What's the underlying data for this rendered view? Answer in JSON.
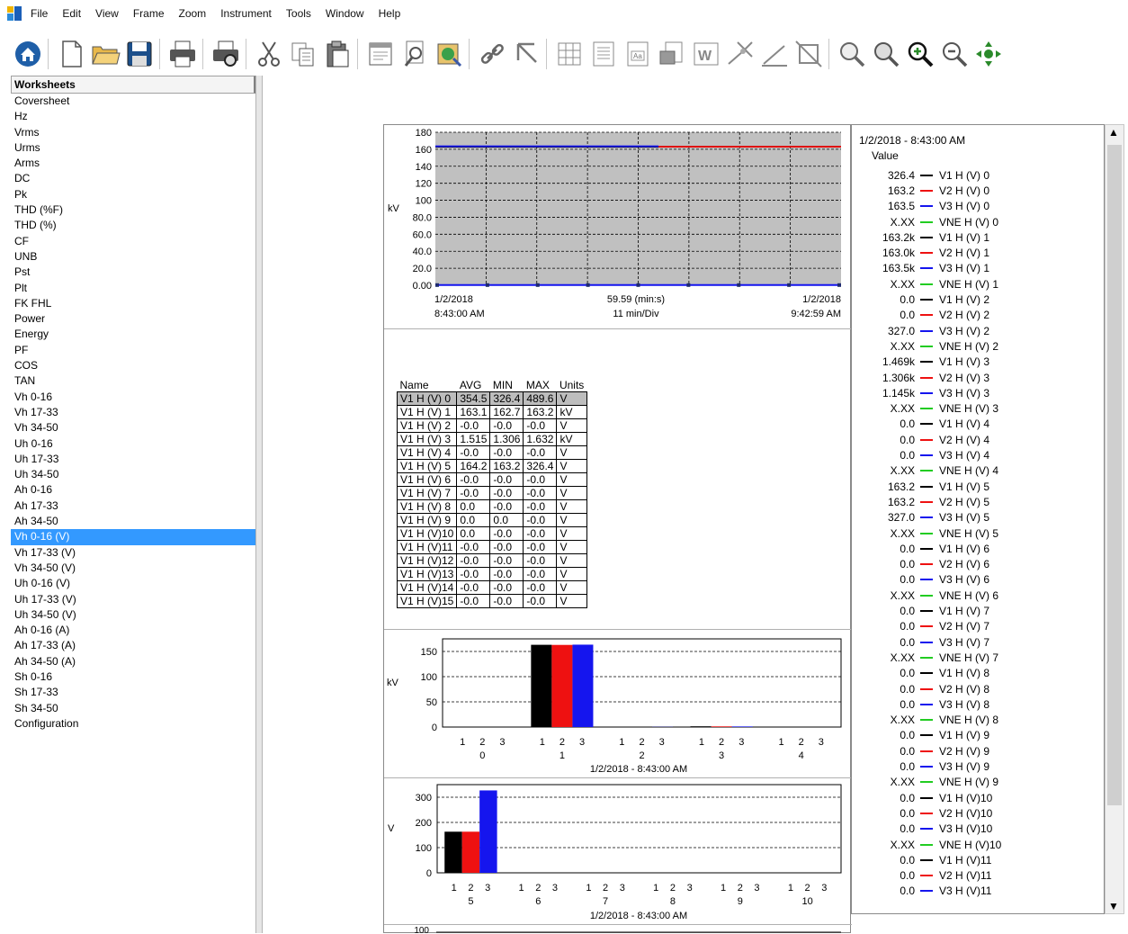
{
  "menu": [
    "File",
    "Edit",
    "View",
    "Frame",
    "Zoom",
    "Instrument",
    "Tools",
    "Window",
    "Help"
  ],
  "toolbar_icons": [
    "home-icon",
    "new-file-icon",
    "open-folder-icon",
    "save-icon",
    "print-icon",
    "print-preview-icon",
    "cut-icon",
    "copy-icon",
    "paste-icon",
    "properties-icon",
    "find-icon",
    "image-icon",
    "link-icon",
    "pointer-icon",
    "table-icon",
    "report-icon",
    "text-icon",
    "export-icon",
    "word-icon",
    "marker-icon",
    "line-tool-icon",
    "crop-icon",
    "zoom-area-icon",
    "zoom-fit-icon",
    "zoom-in-icon",
    "zoom-out-icon",
    "pan-icon"
  ],
  "sidebar": {
    "header": "Worksheets",
    "selected_index": 28,
    "items": [
      "Coversheet",
      "Hz",
      "Vrms",
      "Urms",
      "Arms",
      "DC",
      "Pk",
      "THD (%F)",
      "THD (%)",
      "CF",
      "UNB",
      "Pst",
      "Plt",
      "FK FHL",
      "Power",
      "Energy",
      "PF",
      "COS",
      "TAN",
      "Vh 0-16",
      "Vh 17-33",
      "Vh 34-50",
      "Uh 0-16",
      "Uh 17-33",
      "Uh 34-50",
      "Ah 0-16",
      "Ah 17-33",
      "Ah 34-50",
      "Vh 0-16 (V)",
      "Vh 17-33 (V)",
      "Vh 34-50 (V)",
      "Uh 0-16 (V)",
      "Uh 17-33 (V)",
      "Uh 34-50 (V)",
      "Ah 0-16 (A)",
      "Ah 17-33 (A)",
      "Ah 34-50 (A)",
      "Sh 0-16",
      "Sh 17-33",
      "Sh 34-50",
      "Configuration"
    ]
  },
  "colors": {
    "v1": "#000000",
    "v2": "#ee1111",
    "v3": "#1515ee",
    "vne": "#22cc22",
    "chart_bg": "#c0c0c0",
    "selection": "#3399ff"
  },
  "trend_chart": {
    "ylabel": "kV",
    "yticks": [
      "180",
      "160",
      "140",
      "120",
      "100",
      "80.0",
      "60.0",
      "40.0",
      "20.0",
      "0.00"
    ],
    "x_start": "1/2/2018",
    "x_start_time": "8:43:00 AM",
    "x_mid": "59.59 (min:s)",
    "x_mid_sub": "11 min/Div",
    "x_end": "1/2/2018",
    "x_end_time": "9:42:59 AM"
  },
  "table": {
    "headers": [
      "Name",
      "AVG",
      "MIN",
      "MAX",
      "Units"
    ],
    "rows": [
      [
        "V1 H (V) 0",
        "354.5",
        "326.4",
        "489.6",
        "V"
      ],
      [
        "V1 H (V) 1",
        "163.1",
        "162.7",
        "163.2",
        "kV"
      ],
      [
        "V1 H (V) 2",
        "-0.0",
        "-0.0",
        "-0.0",
        "V"
      ],
      [
        "V1 H (V) 3",
        "1.515",
        "1.306",
        "1.632",
        "kV"
      ],
      [
        "V1 H (V) 4",
        "-0.0",
        "-0.0",
        "-0.0",
        "V"
      ],
      [
        "V1 H (V) 5",
        "164.2",
        "163.2",
        "326.4",
        "V"
      ],
      [
        "V1 H (V) 6",
        "-0.0",
        "-0.0",
        "-0.0",
        "V"
      ],
      [
        "V1 H (V) 7",
        "-0.0",
        "-0.0",
        "-0.0",
        "V"
      ],
      [
        "V1 H (V) 8",
        "0.0",
        "-0.0",
        "-0.0",
        "V"
      ],
      [
        "V1 H (V) 9",
        "0.0",
        "0.0",
        "-0.0",
        "V"
      ],
      [
        "V1 H (V)10",
        "0.0",
        "-0.0",
        "-0.0",
        "V"
      ],
      [
        "V1 H (V)11",
        "-0.0",
        "-0.0",
        "-0.0",
        "V"
      ],
      [
        "V1 H (V)12",
        "-0.0",
        "-0.0",
        "-0.0",
        "V"
      ],
      [
        "V1 H (V)13",
        "-0.0",
        "-0.0",
        "-0.0",
        "V"
      ],
      [
        "V1 H (V)14",
        "-0.0",
        "-0.0",
        "-0.0",
        "V"
      ],
      [
        "V1 H (V)15",
        "-0.0",
        "-0.0",
        "-0.0",
        "V"
      ]
    ]
  },
  "legend": {
    "title": "1/2/2018 - 8:43:00 AM",
    "subtitle": "Value",
    "rows": [
      {
        "value": "326.4",
        "label": "V1 H (V) 0",
        "s": "v1"
      },
      {
        "value": "163.2",
        "label": "V2 H (V) 0",
        "s": "v2"
      },
      {
        "value": "163.5",
        "label": "V3 H (V) 0",
        "s": "v3"
      },
      {
        "value": "X.XX",
        "label": "VNE H (V) 0",
        "s": "vne"
      },
      {
        "value": "163.2k",
        "label": "V1 H (V) 1",
        "s": "v1"
      },
      {
        "value": "163.0k",
        "label": "V2 H (V) 1",
        "s": "v2"
      },
      {
        "value": "163.5k",
        "label": "V3 H (V) 1",
        "s": "v3"
      },
      {
        "value": "X.XX",
        "label": "VNE H (V) 1",
        "s": "vne"
      },
      {
        "value": "0.0",
        "label": "V1 H (V) 2",
        "s": "v1"
      },
      {
        "value": "0.0",
        "label": "V2 H (V) 2",
        "s": "v2"
      },
      {
        "value": "327.0",
        "label": "V3 H (V) 2",
        "s": "v3"
      },
      {
        "value": "X.XX",
        "label": "VNE H (V) 2",
        "s": "vne"
      },
      {
        "value": "1.469k",
        "label": "V1 H (V) 3",
        "s": "v1"
      },
      {
        "value": "1.306k",
        "label": "V2 H (V) 3",
        "s": "v2"
      },
      {
        "value": "1.145k",
        "label": "V3 H (V) 3",
        "s": "v3"
      },
      {
        "value": "X.XX",
        "label": "VNE H (V) 3",
        "s": "vne"
      },
      {
        "value": "0.0",
        "label": "V1 H (V) 4",
        "s": "v1"
      },
      {
        "value": "0.0",
        "label": "V2 H (V) 4",
        "s": "v2"
      },
      {
        "value": "0.0",
        "label": "V3 H (V) 4",
        "s": "v3"
      },
      {
        "value": "X.XX",
        "label": "VNE H (V) 4",
        "s": "vne"
      },
      {
        "value": "163.2",
        "label": "V1 H (V) 5",
        "s": "v1"
      },
      {
        "value": "163.2",
        "label": "V2 H (V) 5",
        "s": "v2"
      },
      {
        "value": "327.0",
        "label": "V3 H (V) 5",
        "s": "v3"
      },
      {
        "value": "X.XX",
        "label": "VNE H (V) 5",
        "s": "vne"
      },
      {
        "value": "0.0",
        "label": "V1 H (V) 6",
        "s": "v1"
      },
      {
        "value": "0.0",
        "label": "V2 H (V) 6",
        "s": "v2"
      },
      {
        "value": "0.0",
        "label": "V3 H (V) 6",
        "s": "v3"
      },
      {
        "value": "X.XX",
        "label": "VNE H (V) 6",
        "s": "vne"
      },
      {
        "value": "0.0",
        "label": "V1 H (V) 7",
        "s": "v1"
      },
      {
        "value": "0.0",
        "label": "V2 H (V) 7",
        "s": "v2"
      },
      {
        "value": "0.0",
        "label": "V3 H (V) 7",
        "s": "v3"
      },
      {
        "value": "X.XX",
        "label": "VNE H (V) 7",
        "s": "vne"
      },
      {
        "value": "0.0",
        "label": "V1 H (V) 8",
        "s": "v1"
      },
      {
        "value": "0.0",
        "label": "V2 H (V) 8",
        "s": "v2"
      },
      {
        "value": "0.0",
        "label": "V3 H (V) 8",
        "s": "v3"
      },
      {
        "value": "X.XX",
        "label": "VNE H (V) 8",
        "s": "vne"
      },
      {
        "value": "0.0",
        "label": "V1 H (V) 9",
        "s": "v1"
      },
      {
        "value": "0.0",
        "label": "V2 H (V) 9",
        "s": "v2"
      },
      {
        "value": "0.0",
        "label": "V3 H (V) 9",
        "s": "v3"
      },
      {
        "value": "X.XX",
        "label": "VNE H (V) 9",
        "s": "vne"
      },
      {
        "value": "0.0",
        "label": "V1 H (V)10",
        "s": "v1"
      },
      {
        "value": "0.0",
        "label": "V2 H (V)10",
        "s": "v2"
      },
      {
        "value": "0.0",
        "label": "V3 H (V)10",
        "s": "v3"
      },
      {
        "value": "X.XX",
        "label": "VNE H (V)10",
        "s": "vne"
      },
      {
        "value": "0.0",
        "label": "V1 H (V)11",
        "s": "v1"
      },
      {
        "value": "0.0",
        "label": "V2 H (V)11",
        "s": "v2"
      },
      {
        "value": "0.0",
        "label": "V3 H (V)11",
        "s": "v3"
      }
    ]
  },
  "bar_chart_1": {
    "ylabel": "kV",
    "yticks": [
      "150",
      "100",
      "50",
      "0"
    ],
    "groups": [
      "0",
      "1",
      "2",
      "3",
      "4"
    ],
    "subs": [
      "1",
      "2",
      "3"
    ],
    "caption": "1/2/2018 - 8:43:00 AM"
  },
  "bar_chart_2": {
    "ylabel": "V",
    "yticks": [
      "300",
      "200",
      "100",
      "0"
    ],
    "groups": [
      "5",
      "6",
      "7",
      "8",
      "9",
      "10"
    ],
    "subs": [
      "1",
      "2",
      "3"
    ],
    "caption": "1/2/2018 - 8:43:00 AM"
  },
  "bottom_chart": {
    "ytick": "100"
  },
  "chart_data": [
    {
      "type": "line",
      "ylabel": "kV",
      "ylim": [
        0,
        180
      ],
      "x": [
        "1/2/2018 8:43:00 AM",
        "1/2/2018 9:42:59 AM"
      ],
      "series": [
        {
          "name": "V1 H (V) 1",
          "values": [
            163,
            163
          ]
        },
        {
          "name": "V2 H (V) 1",
          "values": [
            163,
            163
          ]
        },
        {
          "name": "V3 H (V) 1",
          "values": [
            163.5,
            163.5
          ]
        },
        {
          "name": "V3 H (V) 0",
          "values": [
            0.2,
            0.2
          ]
        }
      ]
    },
    {
      "type": "bar",
      "ylabel": "kV",
      "ylim": [
        0,
        175
      ],
      "categories": [
        "0",
        "1",
        "2",
        "3",
        "4"
      ],
      "series": [
        {
          "name": "1",
          "values": [
            0,
            163.2,
            0,
            1.469,
            0
          ]
        },
        {
          "name": "2",
          "values": [
            0,
            163.0,
            0,
            1.306,
            0
          ]
        },
        {
          "name": "3",
          "values": [
            0,
            163.5,
            0.327,
            1.145,
            0
          ]
        }
      ]
    },
    {
      "type": "bar",
      "ylabel": "V",
      "ylim": [
        0,
        350
      ],
      "categories": [
        "5",
        "6",
        "7",
        "8",
        "9",
        "10"
      ],
      "series": [
        {
          "name": "1",
          "values": [
            163.2,
            0,
            0,
            0,
            0,
            0
          ]
        },
        {
          "name": "2",
          "values": [
            163.2,
            0,
            0,
            0,
            0,
            0
          ]
        },
        {
          "name": "3",
          "values": [
            327.0,
            0,
            0,
            0,
            0,
            0
          ]
        }
      ]
    }
  ]
}
